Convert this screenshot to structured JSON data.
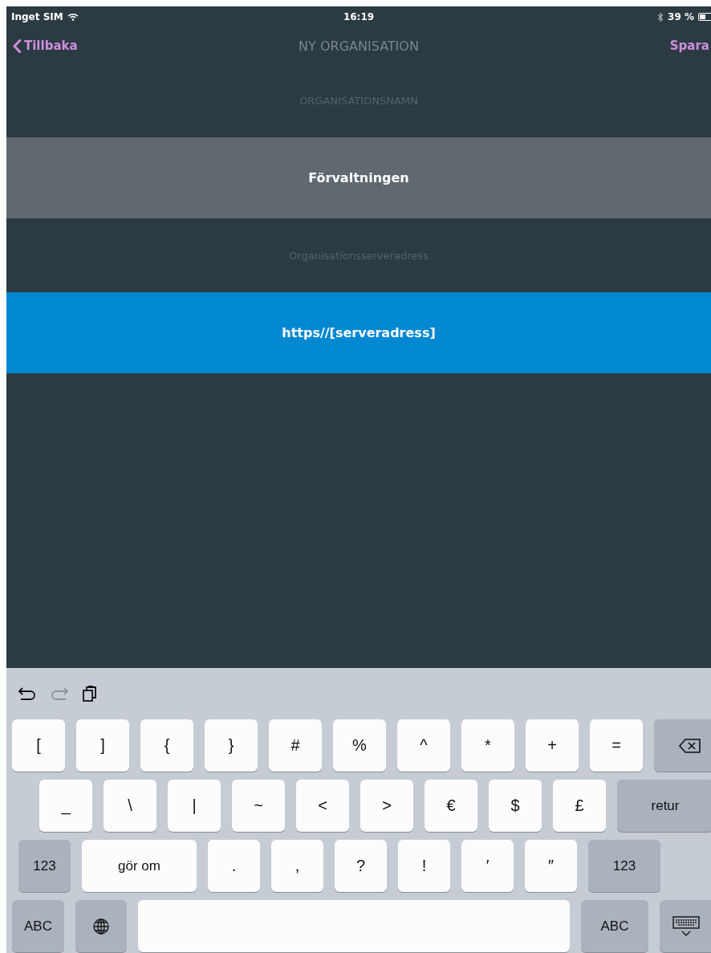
{
  "status_bar": {
    "carrier": "Inget SIM",
    "time": "16:19",
    "battery": "39 %"
  },
  "nav_bar": {
    "back": "Tillbaka",
    "title": "NY ORGANISATION",
    "action": "Spara"
  },
  "form": [
    {
      "label": "ORGANISATIONSNAMN",
      "value": "Förvaltningen",
      "focused": false
    },
    {
      "label": "Organisationsserveradress",
      "value": "https//[serveradress]",
      "focused": true
    }
  ],
  "keyboard": {
    "toolbar": [
      {
        "kind": "undo",
        "disabled": false
      },
      {
        "kind": "redo",
        "disabled": true
      },
      {
        "kind": "paste",
        "disabled": false
      }
    ],
    "rows": [
      [
        {
          "kind": "char",
          "label": "["
        },
        {
          "kind": "char",
          "label": "]"
        },
        {
          "kind": "char",
          "label": "{"
        },
        {
          "kind": "char",
          "label": "}"
        },
        {
          "kind": "char",
          "label": "#"
        },
        {
          "kind": "char",
          "label": "%"
        },
        {
          "kind": "char",
          "label": "^"
        },
        {
          "kind": "char",
          "label": "*"
        },
        {
          "kind": "char",
          "label": "+"
        },
        {
          "kind": "char",
          "label": "="
        },
        {
          "kind": "backspace"
        }
      ],
      [
        {
          "kind": "char",
          "label": "_"
        },
        {
          "kind": "char",
          "label": "\\"
        },
        {
          "kind": "char",
          "label": "|"
        },
        {
          "kind": "char",
          "label": "~"
        },
        {
          "kind": "char",
          "label": "<"
        },
        {
          "kind": "char",
          "label": ">"
        },
        {
          "kind": "char",
          "label": "€"
        },
        {
          "kind": "char",
          "label": "$"
        },
        {
          "kind": "char",
          "label": "£"
        },
        {
          "kind": "mod",
          "label": "retur"
        }
      ],
      [
        {
          "kind": "mod",
          "label": "123"
        },
        {
          "kind": "action",
          "label": "gör om"
        },
        {
          "kind": "char",
          "label": "."
        },
        {
          "kind": "char",
          "label": ","
        },
        {
          "kind": "char",
          "label": "?"
        },
        {
          "kind": "char",
          "label": "!"
        },
        {
          "kind": "char",
          "label": "′"
        },
        {
          "kind": "char",
          "label": "″"
        },
        {
          "kind": "mod",
          "label": "123"
        }
      ],
      [
        {
          "kind": "mod",
          "label": "ABC"
        },
        {
          "kind": "globe"
        },
        {
          "kind": "space"
        },
        {
          "kind": "mod",
          "label": "ABC"
        },
        {
          "kind": "hide"
        }
      ]
    ]
  }
}
